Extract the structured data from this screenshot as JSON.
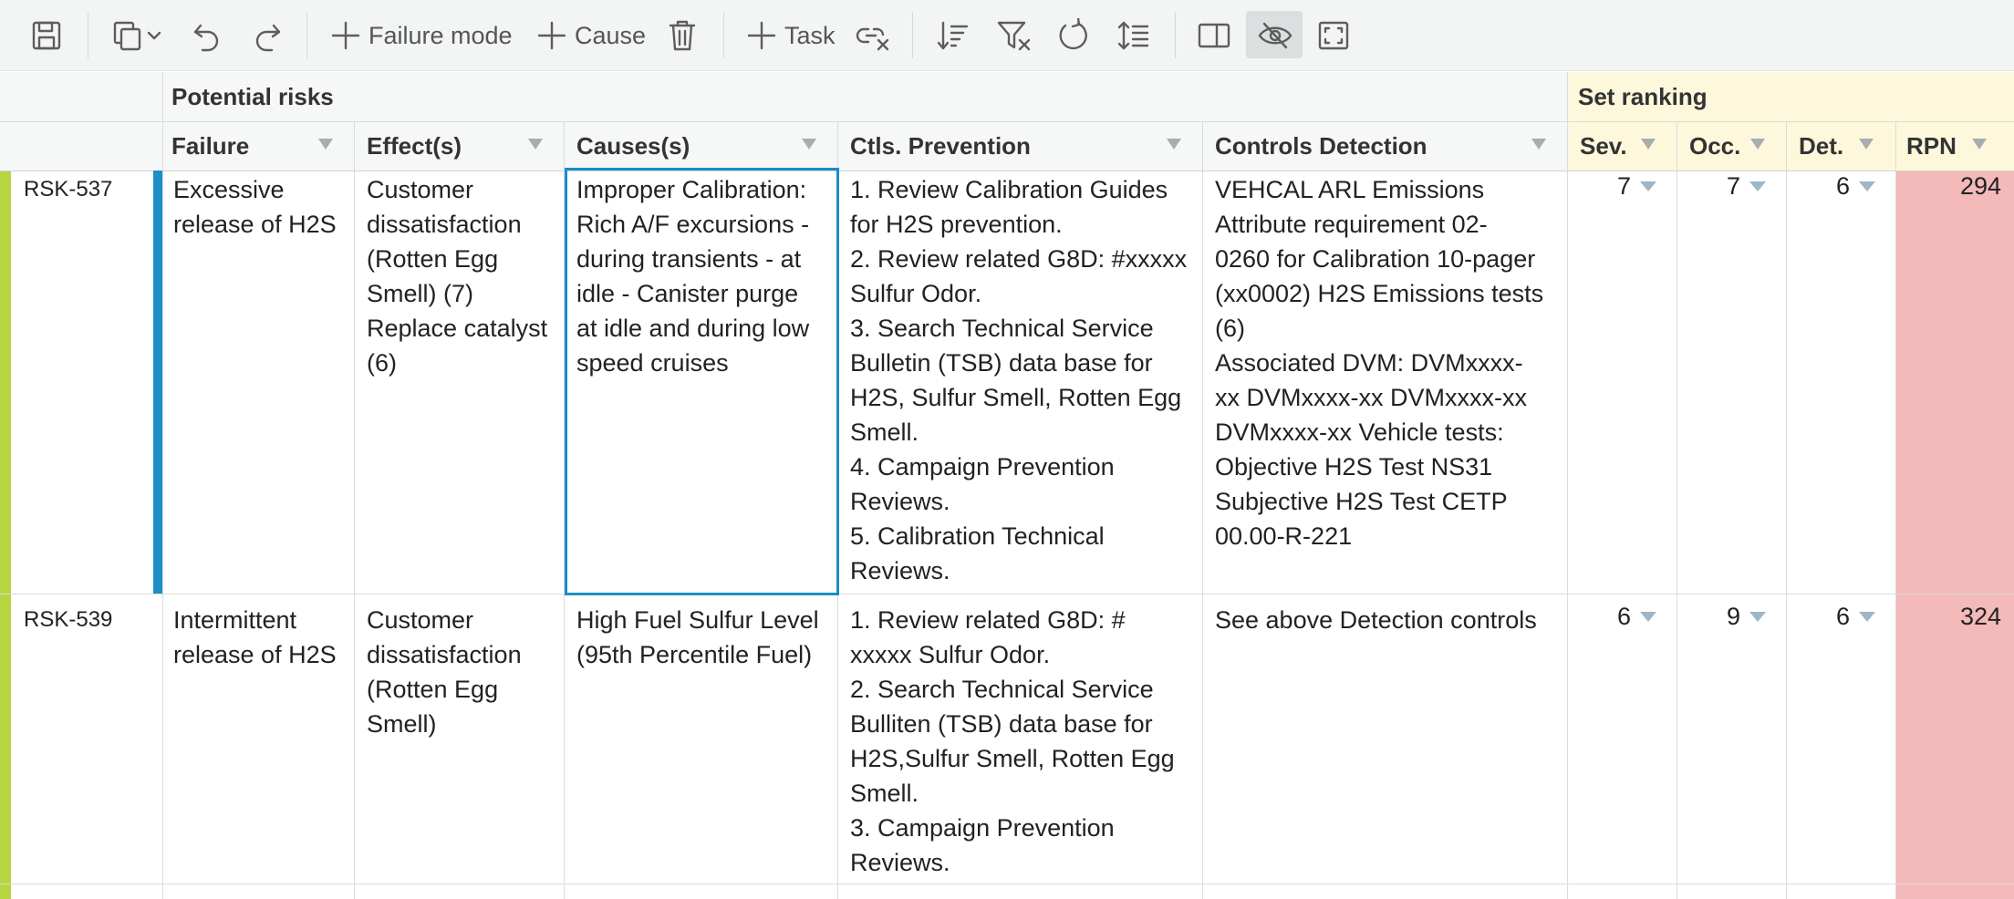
{
  "toolbar": {
    "add_failure_mode": "Failure mode",
    "add_cause": "Cause",
    "add_task": "Task"
  },
  "header": {
    "group_potential_risks": "Potential risks",
    "group_set_ranking": "Set ranking",
    "columns": {
      "failure": "Failure",
      "effects": "Effect(s)",
      "causes": "Causes(s)",
      "ctls_prevention": "Ctls. Prevention",
      "controls_detection": "Controls Detection",
      "sev": "Sev.",
      "occ": "Occ.",
      "det": "Det.",
      "rpn": "RPN"
    }
  },
  "rows": [
    {
      "id": "RSK-537",
      "failure": "Excessive\nrelease of H2S",
      "effects": "Customer\ndissatisfaction\n(Rotten Egg\nSmell) (7)\nReplace catalyst\n(6)",
      "causes": "Improper Calibration:\nRich A/F excursions -\nduring transients - at\nidle - Canister purge\nat idle and during low\nspeed cruises",
      "prevention": "1. Review Calibration Guides\nfor H2S prevention.\n2. Review related G8D: #xxxxx\nSulfur Odor.\n3. Search Technical Service\nBulletin (TSB) data base for\nH2S, Sulfur Smell, Rotten Egg\nSmell.\n4. Campaign Prevention\nReviews.\n5. Calibration Technical\nReviews.",
      "detection": "VEHCAL ARL Emissions\nAttribute requirement 02-\n0260 for Calibration 10-pager\n(xx0002) H2S Emissions tests\n(6)\nAssociated DVM: DVMxxxx-\nxx DVMxxxx-xx DVMxxxx-xx\nDVMxxxx-xx Vehicle tests:\nObjective H2S Test NS31\nSubjective H2S Test CETP\n00.00-R-221",
      "sev": "7",
      "occ": "7",
      "det": "6",
      "rpn": "294"
    },
    {
      "id": "RSK-539",
      "failure": "Intermittent\nrelease of H2S",
      "effects": "Customer\ndissatisfaction\n(Rotten Egg\nSmell)",
      "causes": "High Fuel Sulfur Level\n(95th Percentile Fuel)",
      "prevention": "1. Review related G8D: #\nxxxxx Sulfur Odor.\n2. Search Technical Service\nBulliten (TSB) data base for\nH2S,Sulfur Smell, Rotten Egg\nSmell.\n3. Campaign Prevention\nReviews.",
      "detection": "See above Detection controls",
      "sev": "6",
      "occ": "9",
      "det": "6",
      "rpn": "324"
    }
  ],
  "colors": {
    "rpn_high": "#f4b9b9",
    "ranking_header": "#fdf7dc",
    "row_status": "#b5d541",
    "selection": "#1b8ec8"
  }
}
